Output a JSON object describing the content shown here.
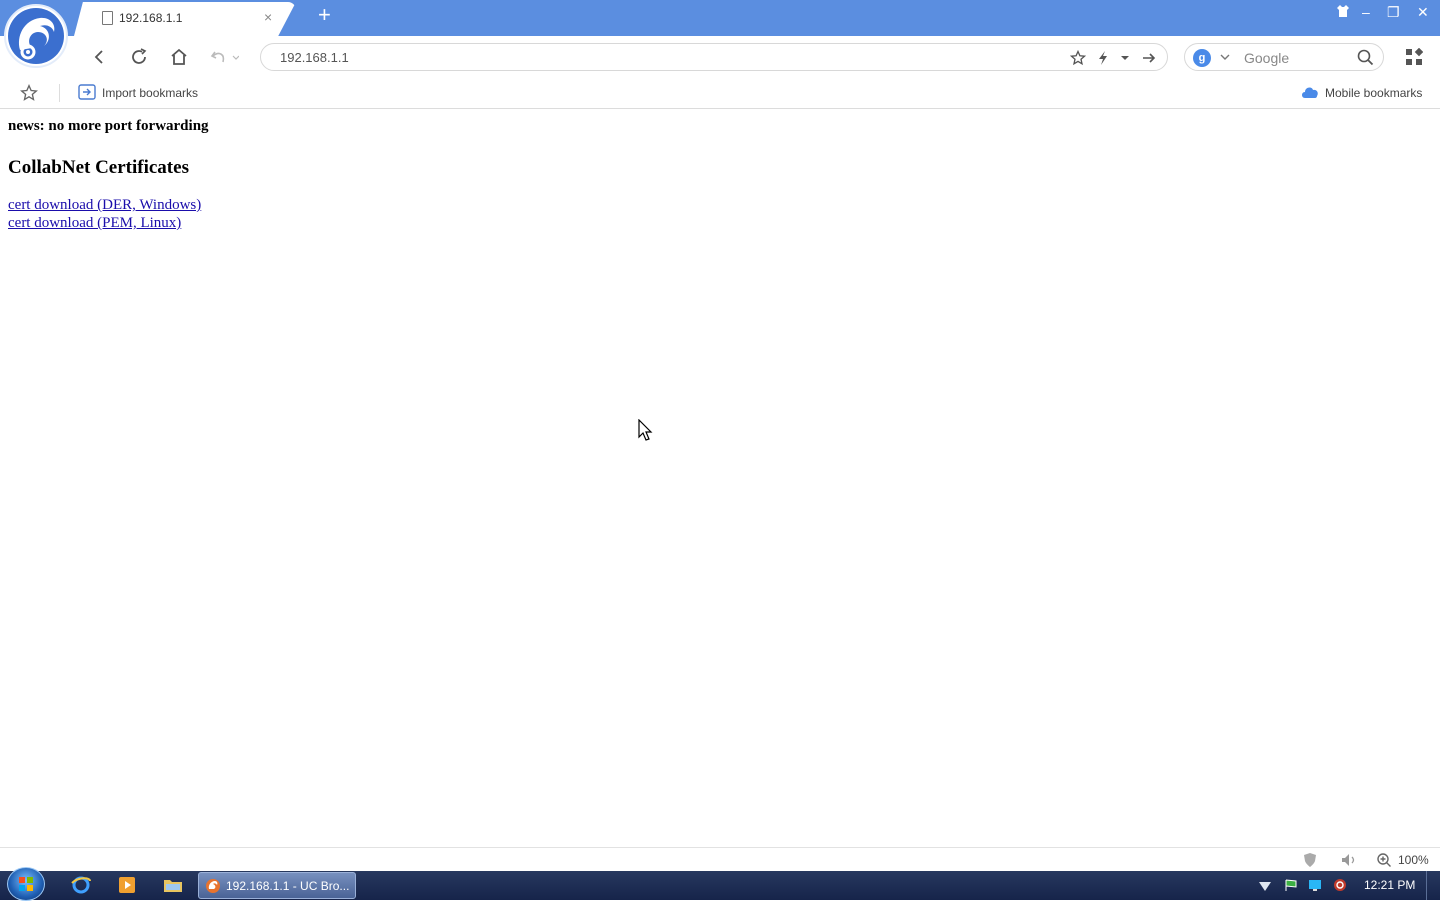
{
  "browser": {
    "tab": {
      "title": "192.168.1.1",
      "close_glyph": "×"
    },
    "new_tab_glyph": "+",
    "window_controls": {
      "skin": "shirt-icon",
      "minimize": "–",
      "maximize": "❐",
      "close": "✕"
    },
    "address": "192.168.1.1",
    "search": {
      "engine_letter": "g",
      "placeholder": "Google"
    },
    "bookmarks": {
      "import_label": "Import bookmarks",
      "mobile_label": "Mobile bookmarks"
    }
  },
  "page": {
    "news": "news: no more port forwarding",
    "heading": "CollabNet Certificates",
    "links": [
      "cert download (DER, Windows)",
      "cert download (PEM, Linux)"
    ]
  },
  "statusbar": {
    "zoom": "100%"
  },
  "taskbar": {
    "task_label": "192.168.1.1 - UC Bro...",
    "clock": "12:21 PM"
  },
  "colors": {
    "titlebar": "#5b8ee0",
    "link": "#1a0dab",
    "taskbar": "#1c2b52"
  }
}
